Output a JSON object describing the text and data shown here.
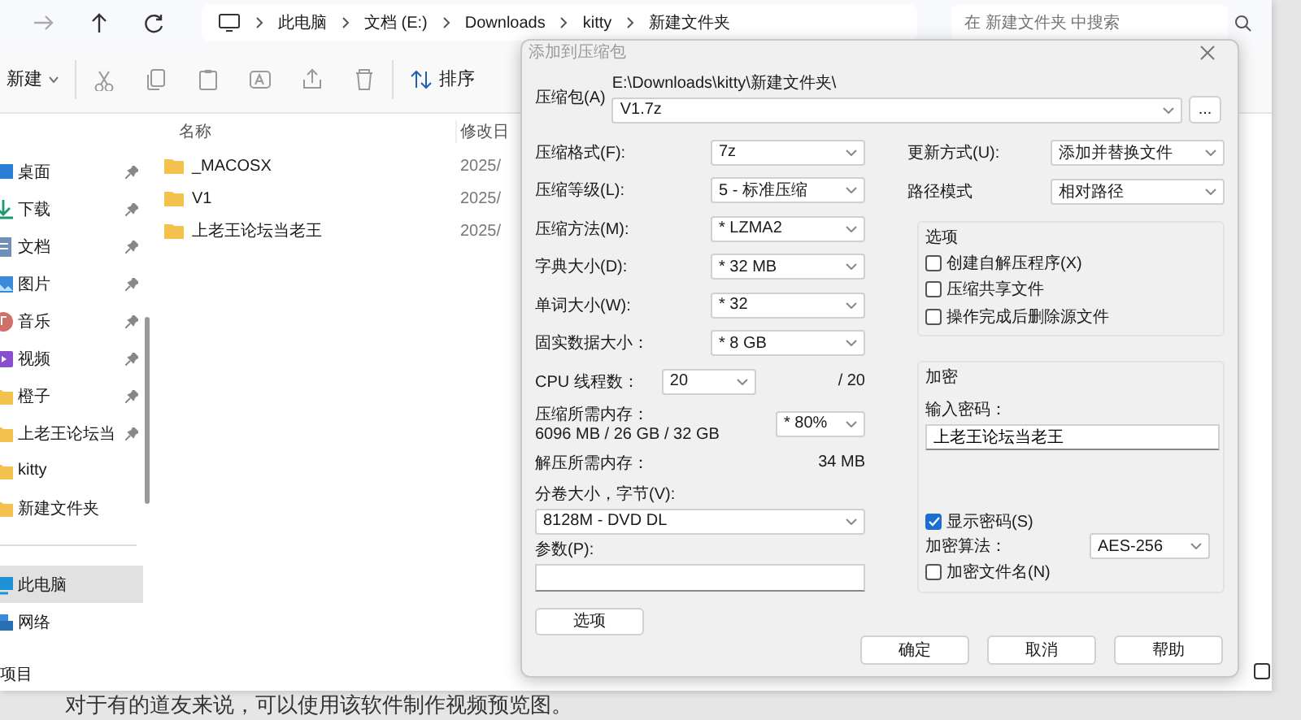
{
  "explorer": {
    "breadcrumb": [
      "此电脑",
      "文档 (E:)",
      "Downloads",
      "kitty",
      "新建文件夹"
    ],
    "search": {
      "placeholder": "在 新建文件夹 中搜索"
    },
    "toolbar": {
      "new": "新建",
      "sort": "排序"
    },
    "columns": [
      "名称",
      "修改日"
    ],
    "files": [
      {
        "name": "_MACOSX",
        "date": "2025/"
      },
      {
        "name": "V1",
        "date": "2025/"
      },
      {
        "name": "上老王论坛当老王",
        "date": "2025/"
      }
    ],
    "sidebar": {
      "quick": [
        {
          "label": "桌面",
          "kind": "desktop",
          "pinned": true,
          "selected": false
        },
        {
          "label": "下载",
          "kind": "download",
          "pinned": true,
          "selected": false
        },
        {
          "label": "文档",
          "kind": "documents",
          "pinned": true,
          "selected": false
        },
        {
          "label": "图片",
          "kind": "pictures",
          "pinned": true,
          "selected": false
        },
        {
          "label": "音乐",
          "kind": "music",
          "pinned": true,
          "selected": false
        },
        {
          "label": "视频",
          "kind": "videos",
          "pinned": true,
          "selected": false
        },
        {
          "label": "橙子",
          "kind": "folder",
          "pinned": true,
          "selected": false
        },
        {
          "label": "上老王论坛当",
          "kind": "folder",
          "pinned": true,
          "selected": false
        },
        {
          "label": "kitty",
          "kind": "folder",
          "pinned": false,
          "selected": false
        },
        {
          "label": "新建文件夹",
          "kind": "folder",
          "pinned": false,
          "selected": false
        }
      ],
      "places": [
        {
          "label": "此电脑",
          "kind": "computer",
          "selected": true
        },
        {
          "label": "网络",
          "kind": "network",
          "selected": false
        }
      ]
    },
    "status_bar": "项目"
  },
  "dialog": {
    "title": "添加到压缩包",
    "archive": {
      "label": "压缩包(A)",
      "path": "E:\\Downloads\\kitty\\新建文件夹\\",
      "value": "V1.7z",
      "browse": "..."
    },
    "fields": [
      {
        "label": "压缩格式(F):",
        "value": "7z"
      },
      {
        "label": "压缩等级(L):",
        "value": "5 - 标准压缩"
      },
      {
        "label": "压缩方法(M):",
        "value": "* LZMA2"
      },
      {
        "label": "字典大小(D):",
        "value": "* 32 MB"
      },
      {
        "label": "单词大小(W):",
        "value": "* 32"
      },
      {
        "label": "固实数据大小：",
        "value": "* 8 GB"
      }
    ],
    "threads": {
      "label": "CPU 线程数：",
      "value": "20",
      "total": "/ 20"
    },
    "memory": {
      "label": "压缩所需内存：",
      "detail": "6096 MB / 26 GB / 32 GB",
      "value": "* 80%"
    },
    "decompress_memory": {
      "label": "解压所需内存：",
      "value": "34 MB"
    },
    "split": {
      "label": "分卷大小，字节(V):",
      "value": "8128M - DVD DL"
    },
    "parameters": {
      "label": "参数(P):"
    },
    "options_button": "选项",
    "update": {
      "label": "更新方式(U):",
      "value": "添加并替换文件"
    },
    "path_mode": {
      "label": "路径模式",
      "value": "相对路径"
    },
    "options": {
      "title": "选项",
      "checkboxes": [
        {
          "label": "创建自解压程序(X)",
          "checked": false
        },
        {
          "label": "压缩共享文件",
          "checked": false
        },
        {
          "label": "操作完成后删除源文件",
          "checked": false
        }
      ]
    },
    "encryption": {
      "title": "加密",
      "password_label": "输入密码：",
      "password": "上老王论坛当老王",
      "show_password": {
        "label": "显示密码(S)",
        "checked": true
      },
      "method": {
        "label": "加密算法：",
        "value": "AES-256"
      },
      "encrypt_names": {
        "label": "加密文件名(N)",
        "checked": false
      }
    },
    "buttons": [
      "确定",
      "取消",
      "帮助"
    ]
  },
  "caption": "对于有的道友来说，可以使用该软件制作视频预览图。"
}
